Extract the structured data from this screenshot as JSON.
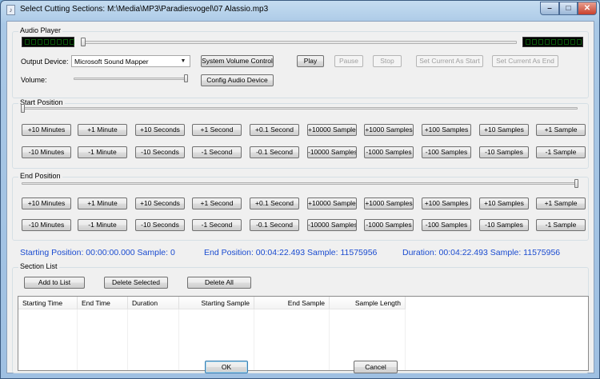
{
  "window": {
    "title": "Select Cutting Sections:  M:\\Media\\MP3\\Paradiesvogel\\07  Alassio.mp3",
    "controls": {
      "minimize": "–",
      "maximize": "□",
      "close": "✕"
    }
  },
  "audio_player": {
    "group_label": "Audio Player",
    "output_device_label": "Output Device:",
    "output_device_value": "Microsoft Sound Mapper",
    "volume_label": "Volume:",
    "volume_level": 1.0,
    "seek_position": 0.0,
    "buttons": {
      "system_volume": "System Volume Control",
      "config_audio": "Config Audio Device",
      "play": "Play",
      "pause": "Pause",
      "stop": "Stop",
      "set_start": "Set Current As Start",
      "set_end": "Set Current As End"
    }
  },
  "start_position": {
    "group_label": "Start Position",
    "slider_position": 0.0,
    "increase": [
      "+10 Minutes",
      "+1 Minute",
      "+10 Seconds",
      "+1 Second",
      "+0.1 Second",
      "+10000 Samples",
      "+1000 Samples",
      "+100 Samples",
      "+10 Samples",
      "+1 Sample"
    ],
    "decrease": [
      "-10 Minutes",
      "-1 Minute",
      "-10 Seconds",
      "-1 Second",
      "-0.1 Second",
      "-10000 Samples",
      "-1000 Samples",
      "-100 Samples",
      "-10 Samples",
      "-1 Sample"
    ]
  },
  "end_position": {
    "group_label": "End Position",
    "slider_position": 1.0,
    "increase": [
      "+10 Minutes",
      "+1 Minute",
      "+10 Seconds",
      "+1 Second",
      "+0.1 Second",
      "+10000 Samples",
      "+1000 Samples",
      "+100 Samples",
      "+10 Samples",
      "+1 Sample"
    ],
    "decrease": [
      "-10 Minutes",
      "-1 Minute",
      "-10 Seconds",
      "-1 Second",
      "-0.1 Second",
      "-10000 Samples",
      "-1000 Samples",
      "-100 Samples",
      "-10 Samples",
      "-1 Sample"
    ]
  },
  "info": {
    "starting": "Starting Position: 00:00:00.000  Sample: 0",
    "ending": "End Position: 00:04:22.493  Sample: 11575956",
    "duration": "Duration: 00:04:22.493  Sample: 11575956"
  },
  "section_list": {
    "group_label": "Section List",
    "add_button": "Add to List",
    "delete_selected_button": "Delete Selected",
    "delete_all_button": "Delete All",
    "columns": [
      "Starting Time",
      "End Time",
      "Duration",
      "Starting Sample",
      "End Sample",
      "Sample Length"
    ],
    "rows": []
  },
  "footer": {
    "ok": "OK",
    "cancel": "Cancel"
  },
  "colors": {
    "info_text": "#1a4bd0",
    "lcd_background": "#000000",
    "title_bar": "#a9c8e6"
  }
}
